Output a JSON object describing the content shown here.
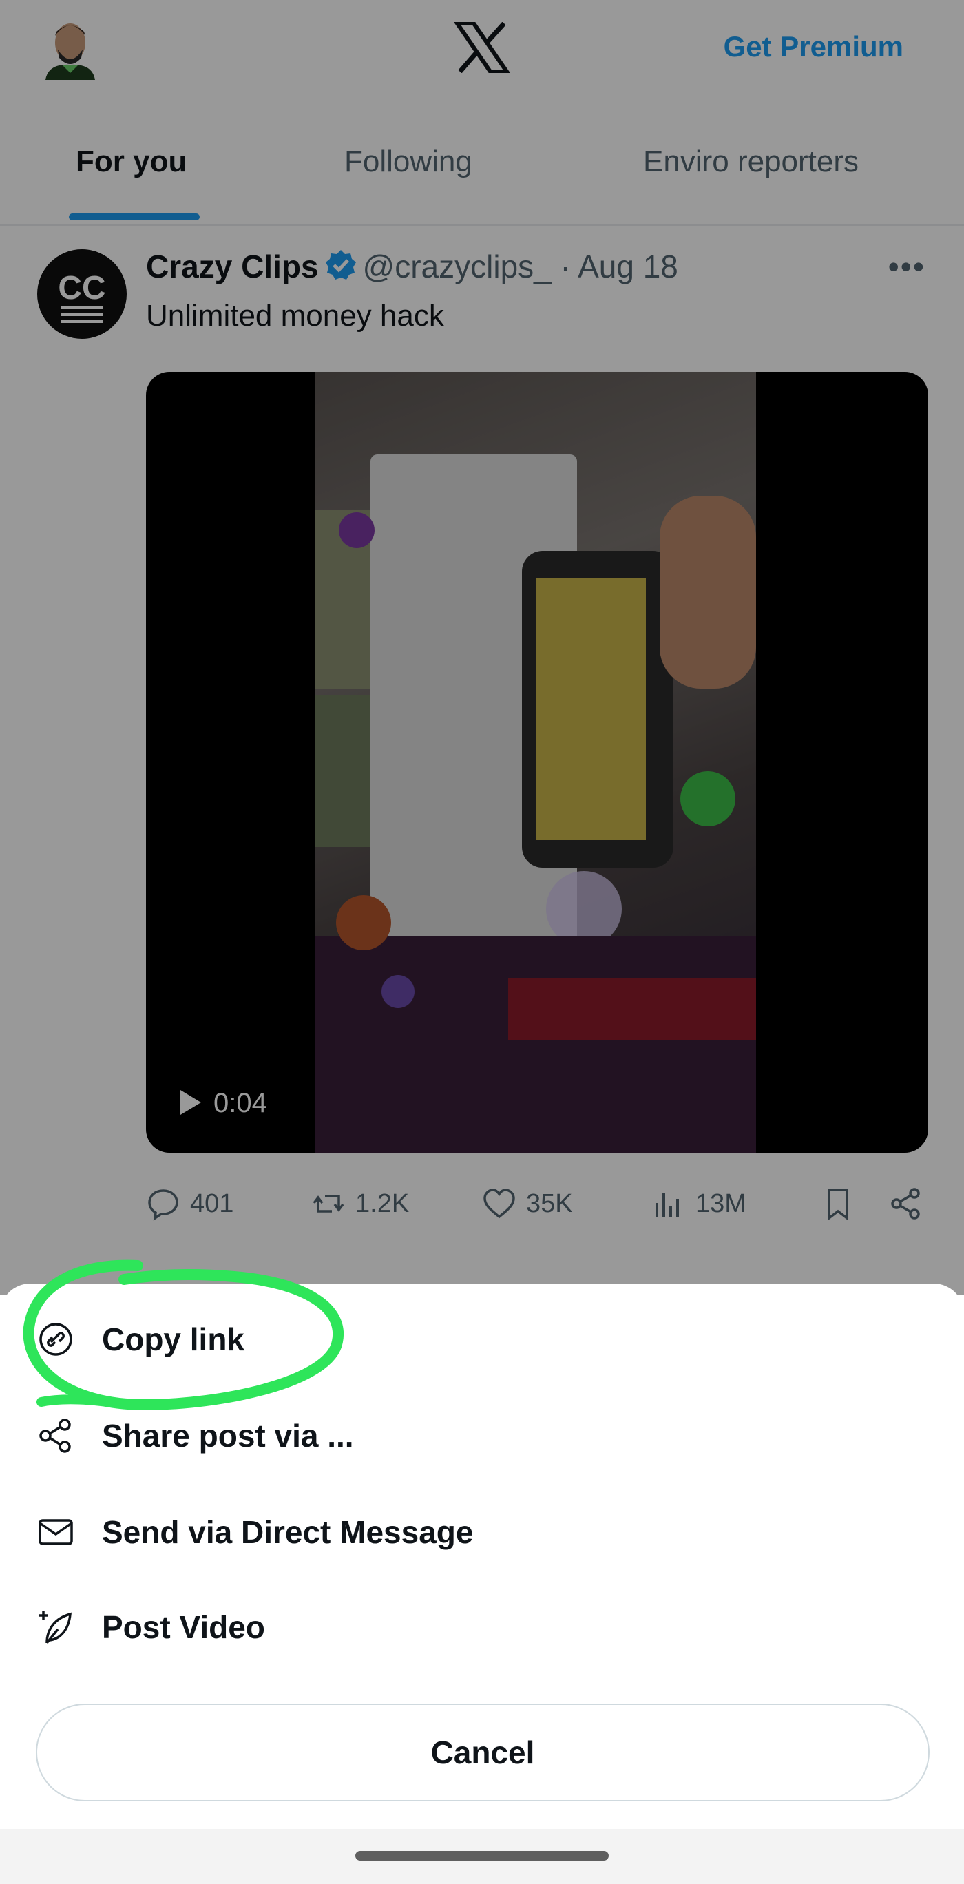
{
  "header": {
    "logo": "x-logo-icon",
    "premium_label": "Get Premium"
  },
  "tabs": [
    {
      "label": "For you",
      "active": true
    },
    {
      "label": "Following",
      "active": false
    },
    {
      "label": "Enviro reporters",
      "active": false
    }
  ],
  "post": {
    "author_initials": "CC",
    "author_name": "Crazy Clips",
    "author_handle": "@crazyclips_ · Aug 18",
    "text": "Unlimited money hack",
    "video_duration": "0:04",
    "actions": {
      "replies": "401",
      "reposts": "1.2K",
      "likes": "35K",
      "views": "13M"
    }
  },
  "share_sheet": {
    "items": [
      {
        "label": "Copy link",
        "icon": "link-icon"
      },
      {
        "label": "Share post via ...",
        "icon": "share-icon"
      },
      {
        "label": "Send via Direct Message",
        "icon": "mail-icon"
      },
      {
        "label": "Post Video",
        "icon": "feather-plus-icon"
      }
    ],
    "cancel_label": "Cancel"
  },
  "colors": {
    "accent": "#1d9bf0",
    "highlight_marker": "#2ee55a",
    "text_primary": "#0f1419",
    "text_secondary": "#536471"
  }
}
